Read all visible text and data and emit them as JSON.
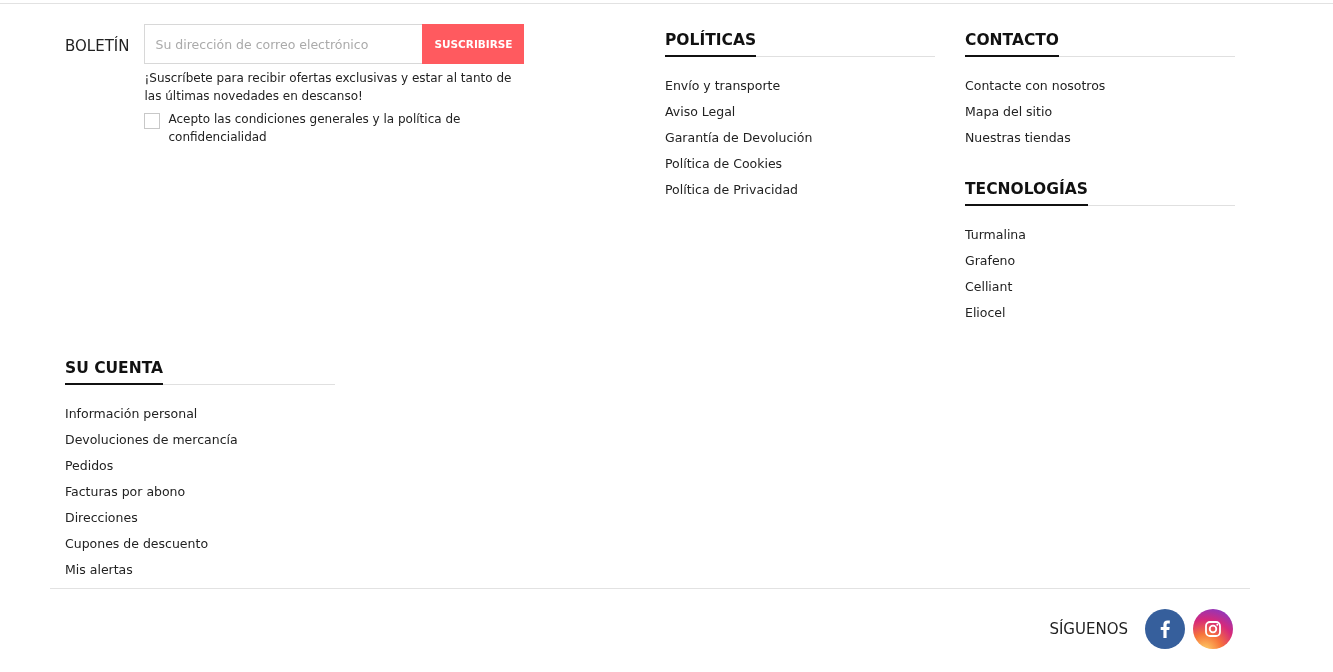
{
  "newsletter": {
    "label": "BOLETÍN",
    "placeholder": "Su dirección de correo electrónico",
    "button": "SUSCRIBIRSE",
    "description": "¡Suscríbete para recibir ofertas exclusivas y estar al tanto de las últimas novedades en descanso!",
    "consent": {
      "label": "Acepto las condiciones generales y la política de confidencialidad",
      "checked": false
    }
  },
  "link_blocks": [
    {
      "title": "POLÍTICAS",
      "links": [
        "Envío y transporte",
        "Aviso Legal",
        "Garantía de Devolución",
        "Política de Cookies",
        "Política de Privacidad"
      ]
    },
    {
      "title": "CONTACTO",
      "links": [
        "Contacte con nosotros",
        "Mapa del sitio",
        "Nuestras tiendas"
      ]
    },
    {
      "title": "TECNOLOGÍAS",
      "links": [
        "Turmalina",
        "Grafeno",
        "Celliant",
        "Eliocel"
      ]
    },
    {
      "title": "SU CUENTA",
      "links": [
        "Información personal",
        "Devoluciones de mercancía",
        "Pedidos",
        "Facturas por abono",
        "Direcciones",
        "Cupones de descuento",
        "Mis alertas"
      ]
    }
  ],
  "social": {
    "label": "SÍGUENOS",
    "networks": [
      {
        "kind": "facebook"
      },
      {
        "kind": "instagram"
      }
    ]
  }
}
